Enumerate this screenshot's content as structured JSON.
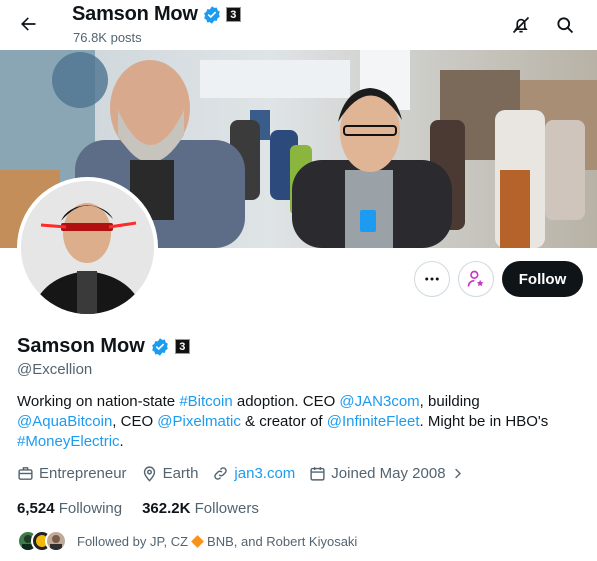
{
  "header": {
    "name": "Samson Mow",
    "posts": "76.8K posts"
  },
  "profile": {
    "name": "Samson Mow",
    "handle": "@Excellion",
    "badge_glyph": "3",
    "verified": true
  },
  "actions": {
    "follow_label": "Follow"
  },
  "bio": {
    "t1": "Working on nation-state ",
    "l1": "#Bitcoin",
    "t2": " adoption. CEO ",
    "l2": "@JAN3com",
    "t3": ", building ",
    "l3": "@AquaBitcoin",
    "t4": ", CEO ",
    "l4": "@Pixelmatic",
    "t5": " & creator of ",
    "l5": "@InfiniteFleet",
    "t6": ". Might be in HBO's ",
    "l6": "#MoneyElectric",
    "t7": "."
  },
  "meta": {
    "profession": "Entrepreneur",
    "location": "Earth",
    "website": "jan3.com",
    "joined": "Joined May 2008"
  },
  "counts": {
    "following_num": "6,524",
    "following_label": "Following",
    "followers_num": "362.2K",
    "followers_label": "Followers"
  },
  "followed_by": {
    "prefix": "Followed by JP, CZ",
    "suffix": "BNB, and Robert Kiyosaki"
  },
  "icons": {
    "back": "arrow-left-icon",
    "notif_off": "bell-slash-icon",
    "search": "search-icon",
    "more": "more-dots-icon",
    "subscribe": "person-star-icon",
    "verified": "verified-badge-icon",
    "affiliate": "affiliate-badge-icon",
    "profession": "briefcase-icon",
    "location": "location-pin-icon",
    "link": "link-icon",
    "calendar": "calendar-icon",
    "chevron": "chevron-right-icon"
  },
  "colors": {
    "accent": "#1d9bf0",
    "text": "#0f1419",
    "muted": "#536471",
    "subscribe": "#c936cc",
    "follow_bg": "#0f1419",
    "bnb": "#f7931a"
  }
}
